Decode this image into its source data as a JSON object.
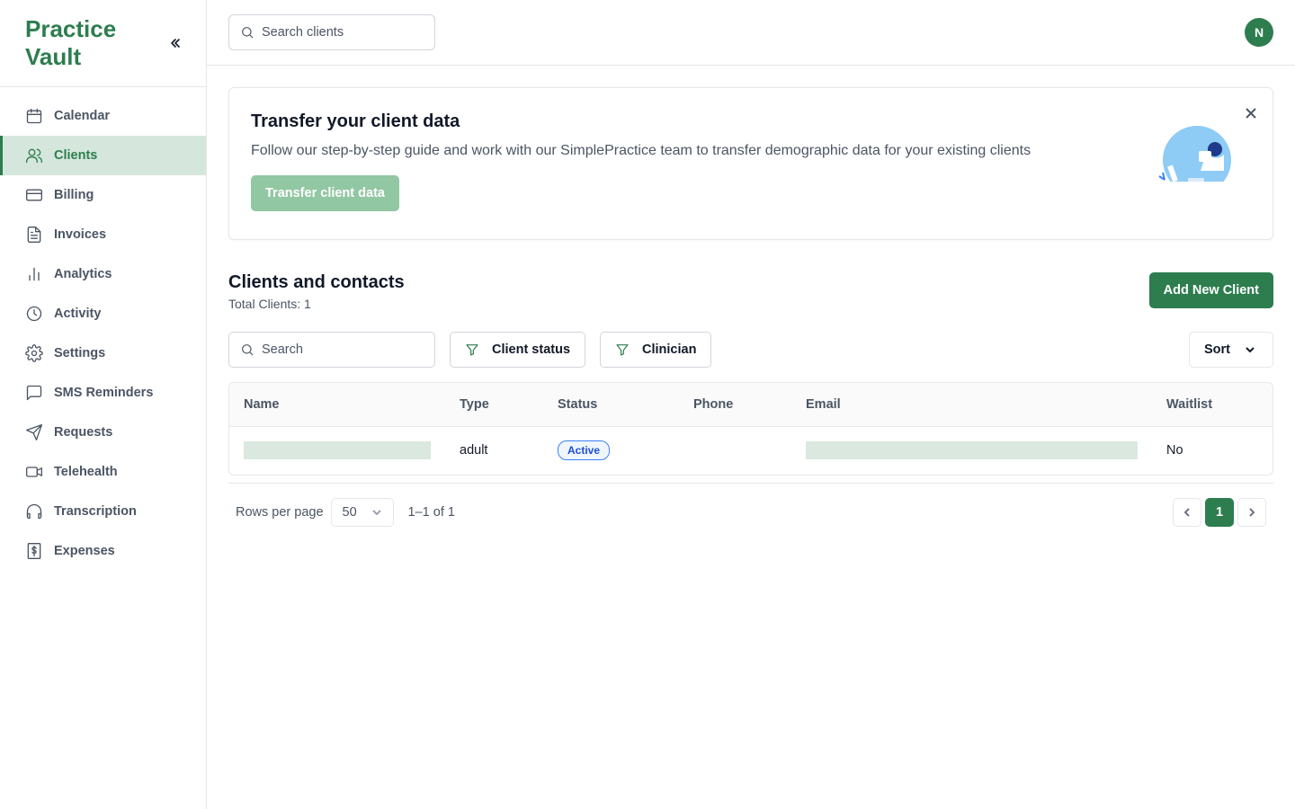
{
  "brand": {
    "name": "Practice Vault"
  },
  "sidebar": {
    "items": [
      {
        "label": "Calendar",
        "icon": "calendar-icon"
      },
      {
        "label": "Clients",
        "icon": "users-icon",
        "active": true
      },
      {
        "label": "Billing",
        "icon": "credit-card-icon"
      },
      {
        "label": "Invoices",
        "icon": "file-text-icon"
      },
      {
        "label": "Analytics",
        "icon": "bar-chart-icon"
      },
      {
        "label": "Activity",
        "icon": "clock-icon"
      },
      {
        "label": "Settings",
        "icon": "gear-icon"
      },
      {
        "label": "SMS Reminders",
        "icon": "message-icon"
      },
      {
        "label": "Requests",
        "icon": "send-icon"
      },
      {
        "label": "Telehealth",
        "icon": "video-icon"
      },
      {
        "label": "Transcription",
        "icon": "headphones-icon"
      },
      {
        "label": "Expenses",
        "icon": "dollar-file-icon"
      }
    ]
  },
  "header": {
    "search_placeholder": "Search clients",
    "avatar_initial": "N"
  },
  "banner": {
    "title": "Transfer your client data",
    "text": "Follow our step-by-step guide and work with our SimplePractice team to transfer demographic data for your existing clients",
    "button_label": "Transfer client data"
  },
  "clients": {
    "title": "Clients and contacts",
    "total": "Total Clients: 1",
    "add_button": "Add New Client",
    "search_placeholder": "Search",
    "filter_status": "Client status",
    "filter_clinician": "Clinician",
    "sort_label": "Sort",
    "columns": [
      "Name",
      "Type",
      "Status",
      "Phone",
      "Email",
      "Waitlist"
    ],
    "rows": [
      {
        "name": "",
        "type": "adult",
        "status": "Active",
        "phone": "",
        "email": "",
        "waitlist": "No"
      }
    ]
  },
  "pagination": {
    "rows_label": "Rows per page",
    "rows_value": "50",
    "range": "1–1 of 1",
    "current_page": "1"
  },
  "colors": {
    "brand": "#2d7d4f",
    "active_bg": "#d5e7dc",
    "button_disabled": "#92c7a3",
    "badge_blue": "#1d4ed8"
  }
}
